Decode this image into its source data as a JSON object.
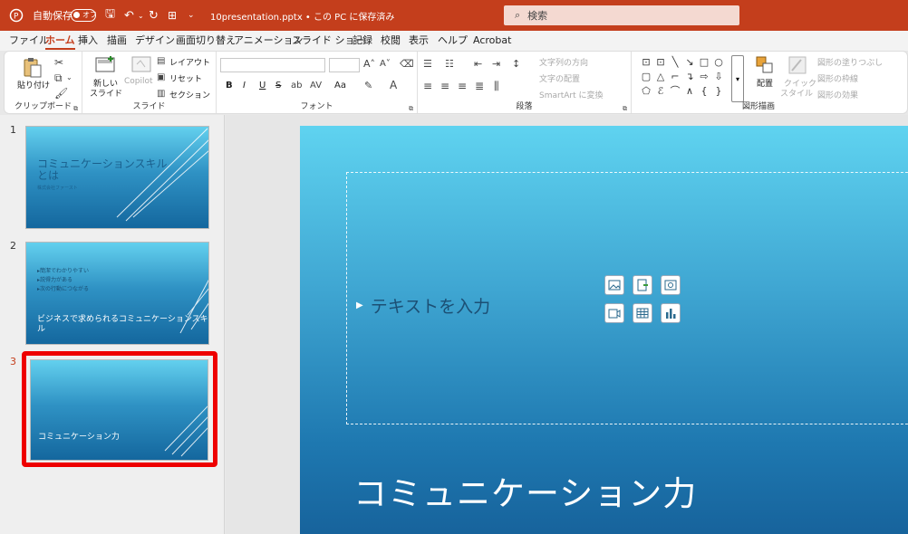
{
  "titlebar": {
    "autosave_label": "自動保存",
    "autosave_state": "オフ",
    "filename": "10presentation.pptx • この PC に保存済み",
    "search_placeholder": "検索",
    "accent_color": "#c43e1c"
  },
  "tabs": [
    "ファイル",
    "ホーム",
    "挿入",
    "描画",
    "デザイン",
    "画面切り替え",
    "アニメーション",
    "スライド ショー",
    "記録",
    "校閲",
    "表示",
    "ヘルプ",
    "Acrobat"
  ],
  "active_tab": "ホーム",
  "ribbon": {
    "clipboard": {
      "paste": "貼り付け",
      "label": "クリップボード"
    },
    "slides": {
      "new_slide": "新しい",
      "new_slide2": "スライド",
      "copilot": "Copilot",
      "layout": "レイアウト",
      "reset": "リセット",
      "section": "セクション",
      "label": "スライド"
    },
    "font": {
      "label": "フォント",
      "bold": "B",
      "italic": "I",
      "underline": "U",
      "strike": "S",
      "aa": "Aa"
    },
    "paragraph": {
      "text_direction": "文字列の方向",
      "align_text": "文字の配置",
      "smartart": "SmartArt に変換",
      "label": "段落"
    },
    "drawing": {
      "arrange": "配置",
      "quick_styles": "クイック",
      "quick_styles2": "スタイル",
      "fill": "図形の塗りつぶし",
      "outline": "図形の枠線",
      "effects": "図形の効果",
      "label": "図形描画"
    }
  },
  "thumbnails": [
    {
      "number": "1",
      "title": "コミュニケーションスキル",
      "title2": "とは",
      "subtitle": "株式会社ファースト"
    },
    {
      "number": "2",
      "bullets": [
        "▸簡潔でわかりやすい",
        "▸説得力がある",
        "▸次の行動につながる"
      ],
      "title": "ビジネスで求められるコミュニケーションスキル"
    },
    {
      "number": "3",
      "title": "コミュニケーション力",
      "selected": true
    }
  ],
  "slide": {
    "placeholder_text": "テキストを入力",
    "title": "コミュニケーション力"
  }
}
